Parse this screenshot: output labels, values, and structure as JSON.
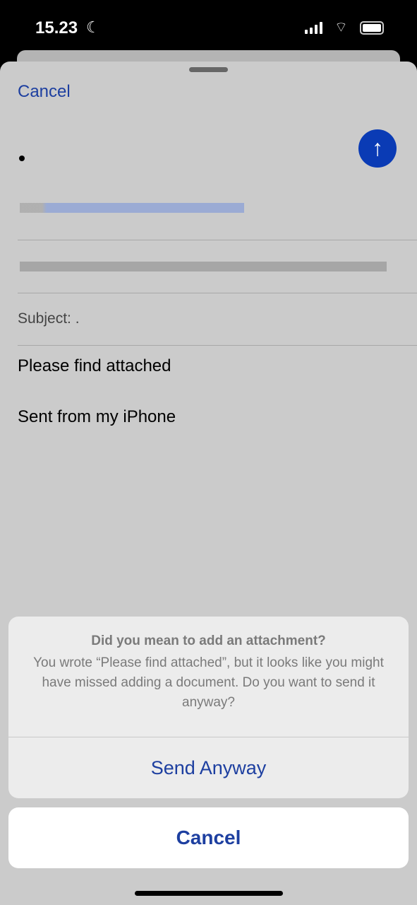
{
  "status_bar": {
    "time": "15.23",
    "focus_icon": "moon-icon",
    "signal": "4 bars",
    "battery": "full"
  },
  "compose": {
    "cancel_label": "Cancel",
    "to_value": "•",
    "send_icon": "arrow-up-icon",
    "subject_label": "Subject:",
    "subject_value": ".",
    "body_line1": "Please find attached",
    "body_line2": "Sent from my iPhone",
    "accent_color": "#1d3fa0"
  },
  "alert": {
    "title": "Did you mean to add an attachment?",
    "message": "You wrote “Please find attached”, but it looks like you might have missed adding a document. Do you want to send it anyway?",
    "send_anyway_label": "Send Anyway",
    "cancel_label": "Cancel"
  }
}
